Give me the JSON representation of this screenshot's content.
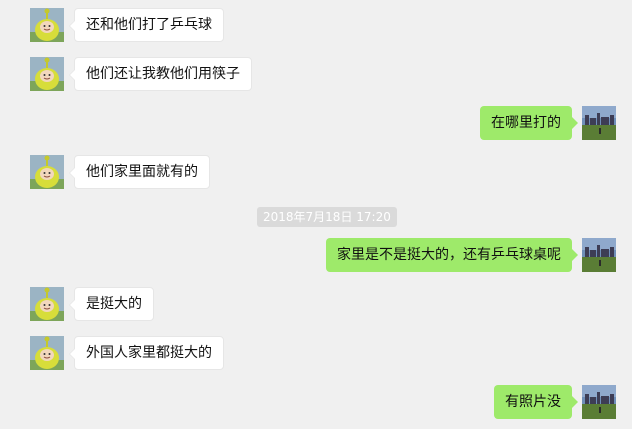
{
  "chat": {
    "messages": [
      {
        "side": "left",
        "text": "还和他们打了乒乓球"
      },
      {
        "side": "left",
        "text": "他们还让我教他们用筷子"
      },
      {
        "side": "right",
        "text": "在哪里打的"
      },
      {
        "side": "left",
        "text": "他们家里面就有的"
      },
      {
        "side": "right",
        "text": "家里是不是挺大的，还有乒乓球桌呢"
      },
      {
        "side": "left",
        "text": "是挺大的"
      },
      {
        "side": "left",
        "text": "外国人家里都挺大的"
      },
      {
        "side": "right",
        "text": "有照片没"
      }
    ],
    "timestamp": "2018年7月18日 17:20"
  },
  "avatars": {
    "left": "teletubby-avatar",
    "right": "landscape-avatar"
  },
  "colors": {
    "background": "#f0f0f0",
    "bubble_left": "#ffffff",
    "bubble_right": "#9eea6a",
    "timestamp_bg": "#dadada"
  }
}
